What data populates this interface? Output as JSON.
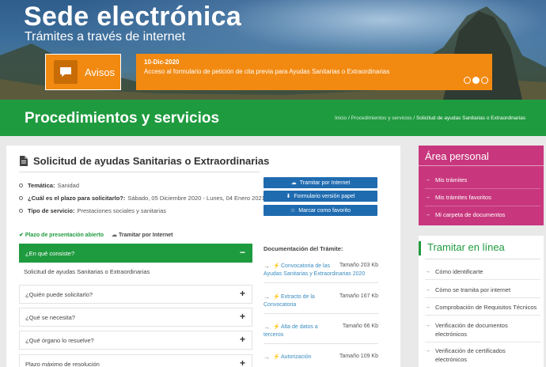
{
  "hero": {
    "title": "Sede electrónica",
    "subtitle": "Trámites a través de internet",
    "avisos_label": "Avisos",
    "news_date": "10-Dic-2020",
    "news_text": "Acceso al formulario de petición de cita previa para Ayudas Sanitarias o Extraordinarias",
    "slider_active": 1,
    "slider_count": 3
  },
  "band": {
    "title": "Procedimientos y servicios",
    "breadcrumb": [
      "Inicio",
      "Procedimientos y servicios",
      "Solicitud de ayudas Sanitarias o Extraordinarias"
    ]
  },
  "main": {
    "title": "Solicitud de ayudas Sanitarias o Extraordinarias",
    "meta": [
      {
        "label": "Temática:",
        "value": "Sanidad"
      },
      {
        "label": "¿Cuál es el plazo para solicitarlo?:",
        "value": "Sábado, 05 Diciembre 2020 - Lunes, 04 Enero 2021"
      },
      {
        "label": "Tipo de servicio:",
        "value": "Prestaciones sociales y sanitarias"
      }
    ],
    "buttons": [
      "Tramitar por Internet",
      "Formulario versión papel",
      "Marcar como favorito"
    ],
    "status_open": "Plazo de presentación abierto",
    "status_internet": "Tramitar por Internet",
    "accordion": [
      {
        "title": "¿En qué consiste?",
        "sign": "−"
      },
      {
        "title": "¿Quién puede solicitarlo?",
        "sign": "+"
      },
      {
        "title": "¿Qué se necesita?",
        "sign": "+"
      },
      {
        "title": "¿Qué órgano lo resuelve?",
        "sign": "+"
      },
      {
        "title": "Plazo máximo de resolución",
        "sign": "+"
      }
    ],
    "accordion_body": "Solicitud de ayudas Sanitarias o Extraordinarias",
    "docs_title": "Documentación del Trámite:",
    "docs": [
      {
        "name_line1": "Convocatoria de las",
        "name_line2": "Ayudas Sanitarias y Extraordinarias 2020",
        "size": "Tamaño 203 Kb"
      },
      {
        "name_line1": "Extracto de la",
        "name_line2": "Convocatoria",
        "size": "Tamaño 167 Kb"
      },
      {
        "name_line1": "Alta de datos a",
        "name_line2": "terceros",
        "size": "Tamaño 66 Kb"
      },
      {
        "name_line1": "Autorización",
        "name_line2": "",
        "size": "Tamaño 109 Kb"
      }
    ]
  },
  "area_personal": {
    "title": "Área personal",
    "items": [
      "Mis trámites",
      "Mis trámites favoritos",
      "Mi carpeta de documentos"
    ]
  },
  "tramitar": {
    "title": "Tramitar en línea",
    "items": [
      {
        "line1": "Cómo identificarte",
        "line2": ""
      },
      {
        "line1": "Cómo se tramita por internet",
        "line2": ""
      },
      {
        "line1": "Comprobación de Requisitos Técnicos",
        "line2": ""
      },
      {
        "line1": "Verificación de documentos",
        "line2": "electrónicos"
      },
      {
        "line1": "Verificación de certificados",
        "line2": "electrónicos"
      }
    ]
  },
  "colors": {
    "green": "#1f9b3f",
    "orange": "#f28a12",
    "magenta": "#c8377d",
    "blue_button": "#1f6bb0"
  }
}
